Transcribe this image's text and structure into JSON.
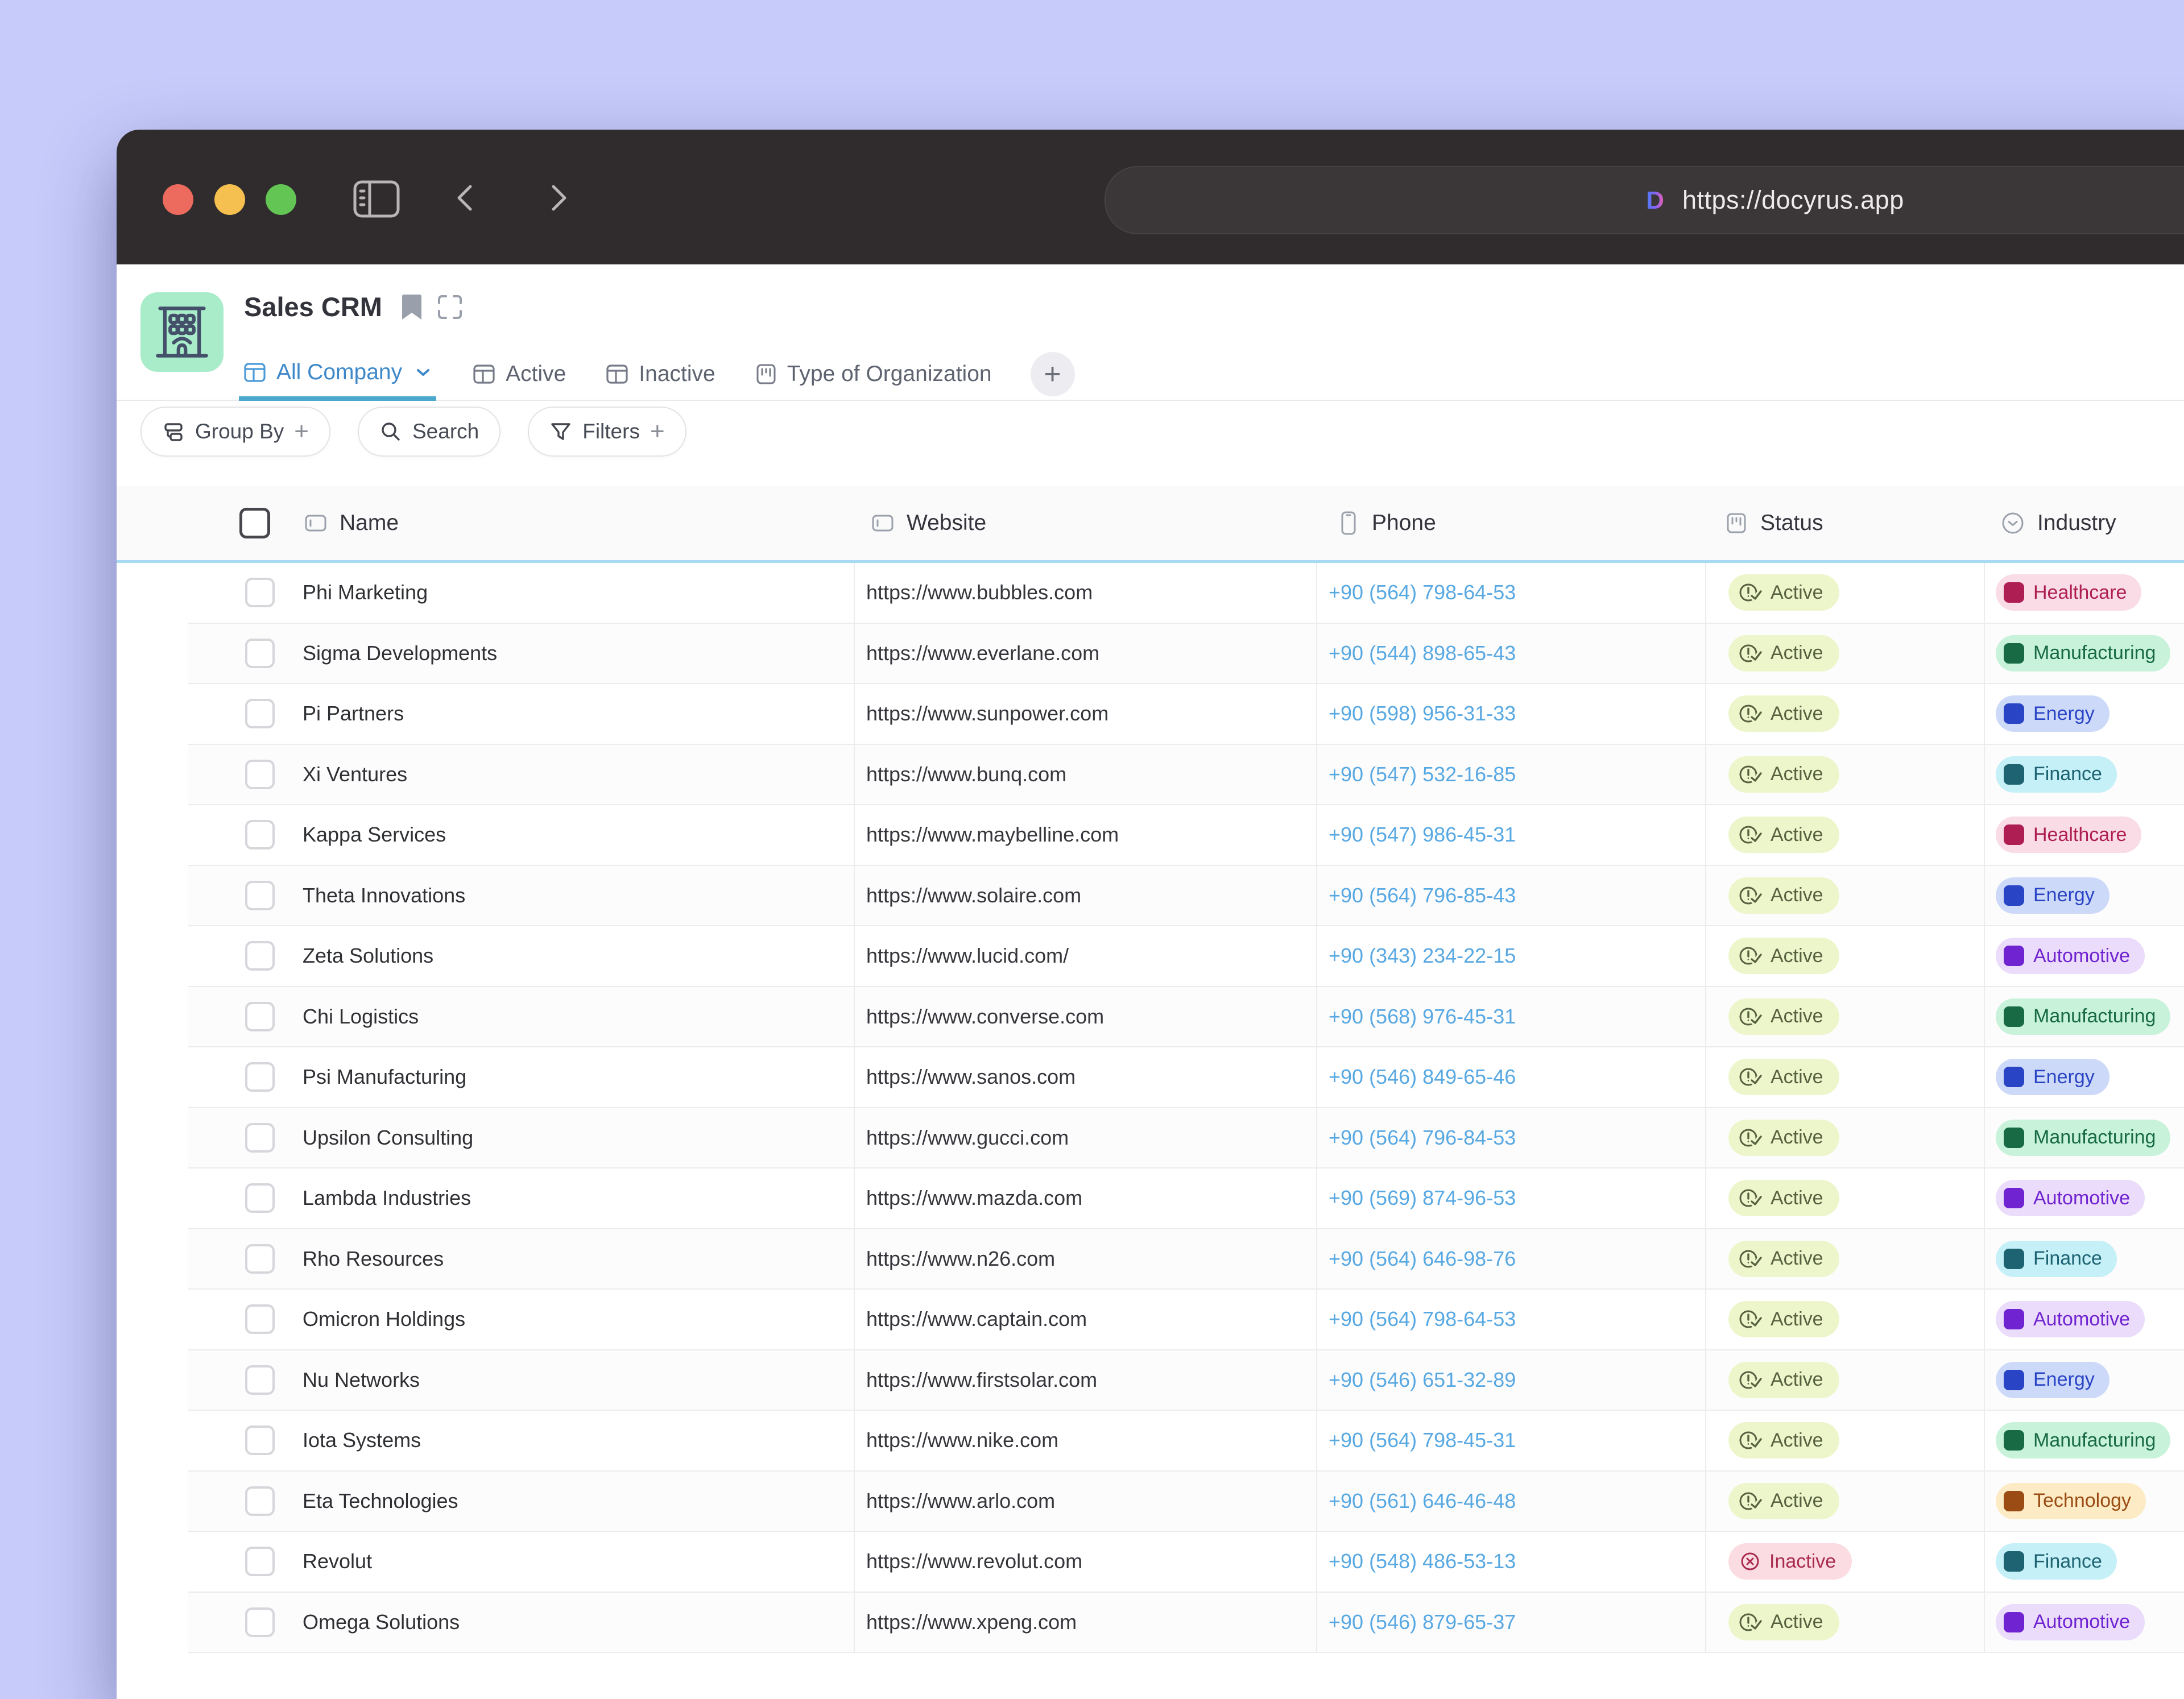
{
  "browser": {
    "url": "https://docyrus.app",
    "logo_letter": "D"
  },
  "app": {
    "title": "Sales CRM",
    "tabs": [
      {
        "label": "All Company",
        "icon": "table",
        "active": true,
        "chevron": true
      },
      {
        "label": "Active",
        "icon": "table",
        "active": false
      },
      {
        "label": "Inactive",
        "icon": "table",
        "active": false
      },
      {
        "label": "Type of Organization",
        "icon": "kanban",
        "active": false
      }
    ],
    "add_tab_glyph": "+",
    "toolbar": {
      "group_by_label": "Group By",
      "search_label": "Search",
      "filters_label": "Filters",
      "plus_glyph": "+"
    },
    "table": {
      "columns": [
        {
          "key": "name",
          "label": "Name",
          "icon": "field"
        },
        {
          "key": "website",
          "label": "Website",
          "icon": "field"
        },
        {
          "key": "phone",
          "label": "Phone",
          "icon": "phone"
        },
        {
          "key": "status",
          "label": "Status",
          "icon": "kanban"
        },
        {
          "key": "industry",
          "label": "Industry",
          "icon": "circle-chevron"
        }
      ],
      "rows": [
        {
          "name": "Phi Marketing",
          "website": "https://www.bubbles.com",
          "phone": "+90 (564) 798-64-53",
          "status": "Active",
          "industry": "Healthcare"
        },
        {
          "name": "Sigma Developments",
          "website": "https://www.everlane.com",
          "phone": "+90 (544) 898-65-43",
          "status": "Active",
          "industry": "Manufacturing"
        },
        {
          "name": "Pi Partners",
          "website": "https://www.sunpower.com",
          "phone": "+90 (598) 956-31-33",
          "status": "Active",
          "industry": "Energy"
        },
        {
          "name": "Xi Ventures",
          "website": "https://www.bunq.com",
          "phone": "+90 (547) 532-16-85",
          "status": "Active",
          "industry": "Finance"
        },
        {
          "name": "Kappa Services",
          "website": "https://www.maybelline.com",
          "phone": "+90 (547) 986-45-31",
          "status": "Active",
          "industry": "Healthcare"
        },
        {
          "name": "Theta Innovations",
          "website": "https://www.solaire.com",
          "phone": "+90 (564) 796-85-43",
          "status": "Active",
          "industry": "Energy"
        },
        {
          "name": "Zeta Solutions",
          "website": "https://www.lucid.com/",
          "phone": "+90 (343) 234-22-15",
          "status": "Active",
          "industry": "Automotive"
        },
        {
          "name": "Chi Logistics",
          "website": "https://www.converse.com",
          "phone": "+90 (568) 976-45-31",
          "status": "Active",
          "industry": "Manufacturing"
        },
        {
          "name": "Psi Manufacturing",
          "website": "https://www.sanos.com",
          "phone": "+90 (546) 849-65-46",
          "status": "Active",
          "industry": "Energy"
        },
        {
          "name": "Upsilon Consulting",
          "website": "https://www.gucci.com",
          "phone": "+90 (564) 796-84-53",
          "status": "Active",
          "industry": "Manufacturing"
        },
        {
          "name": "Lambda Industries",
          "website": "https://www.mazda.com",
          "phone": "+90 (569) 874-96-53",
          "status": "Active",
          "industry": "Automotive"
        },
        {
          "name": "Rho Resources",
          "website": "https://www.n26.com",
          "phone": "+90 (564) 646-98-76",
          "status": "Active",
          "industry": "Finance"
        },
        {
          "name": "Omicron Holdings",
          "website": "https://www.captain.com",
          "phone": "+90 (564) 798-64-53",
          "status": "Active",
          "industry": "Automotive"
        },
        {
          "name": "Nu Networks",
          "website": "https://www.firstsolar.com",
          "phone": "+90 (546) 651-32-89",
          "status": "Active",
          "industry": "Energy"
        },
        {
          "name": "Iota Systems",
          "website": "https://www.nike.com",
          "phone": "+90 (564) 798-45-31",
          "status": "Active",
          "industry": "Manufacturing"
        },
        {
          "name": "Eta Technologies",
          "website": "https://www.arlo.com",
          "phone": "+90 (561) 646-46-48",
          "status": "Active",
          "industry": "Technology"
        },
        {
          "name": "Revolut",
          "website": "https://www.revolut.com",
          "phone": "+90 (548) 486-53-13",
          "status": "Inactive",
          "industry": "Finance"
        },
        {
          "name": "Omega Solutions",
          "website": "https://www.xpeng.com",
          "phone": "+90 (546) 879-65-37",
          "status": "Active",
          "industry": "Automotive"
        }
      ]
    },
    "colors": {
      "status": {
        "Active": {
          "bg": "#edf6cb",
          "fg": "#57603f"
        },
        "Inactive": {
          "bg": "#fadce2",
          "fg": "#a92b50"
        }
      },
      "industry": {
        "Healthcare": {
          "bg": "#f9dce6",
          "fg": "#ae1e52"
        },
        "Manufacturing": {
          "bg": "#c8f3da",
          "fg": "#176a44"
        },
        "Energy": {
          "bg": "#cdd9f8",
          "fg": "#2944c5"
        },
        "Finance": {
          "bg": "#c6f0f7",
          "fg": "#1d6372"
        },
        "Automotive": {
          "bg": "#eadcfa",
          "fg": "#7023d0"
        },
        "Technology": {
          "bg": "#fcebc4",
          "fg": "#9a4c14"
        }
      },
      "phone_link": "#58a8e2",
      "tab_active": "#3e88c9",
      "tab_underline": "#4aa9cd",
      "header_border": "#a8daf3"
    }
  }
}
